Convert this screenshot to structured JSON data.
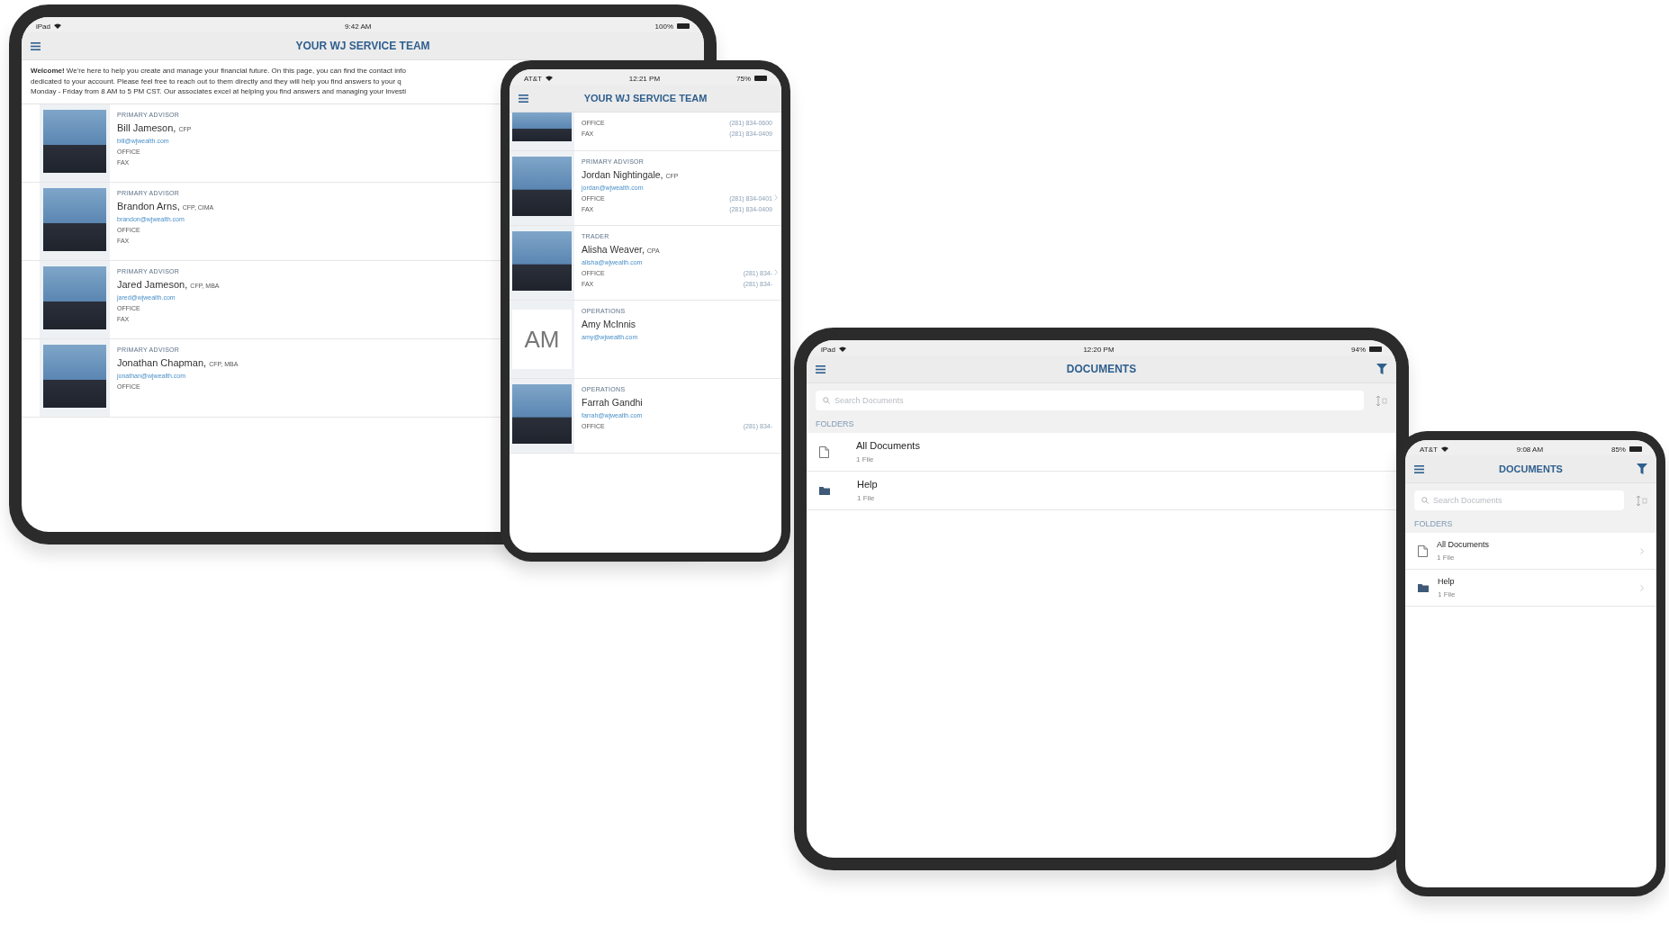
{
  "devices": [
    {
      "kind": "tablet",
      "status": {
        "carrier": "iPad",
        "time": "9:42 AM",
        "battery": "100%"
      },
      "title": "YOUR WJ SERVICE TEAM",
      "intro_lines": [
        "**Welcome!** We're here to help you create and manage your financial future. On this page, you can find the contact info",
        "dedicated to your account. Please feel free to reach out to them directly and they will help you find answers to your q",
        "Monday - Friday from 8 AM to 5 PM CST. Our associates excel at helping you find answers and managing your investi"
      ],
      "members": [
        {
          "role": "PRIMARY ADVISOR",
          "name": "Bill Jameson,",
          "credentials": "CFP",
          "email": "bill@wjwealth.com",
          "fields": [
            {
              "label": "OFFICE"
            },
            {
              "label": "FAX"
            }
          ]
        },
        {
          "role": "PRIMARY ADVISOR",
          "name": "Brandon Arns,",
          "credentials": "CFP, CIMA",
          "email": "brandon@wjwealth.com",
          "fields": [
            {
              "label": "OFFICE"
            },
            {
              "label": "FAX"
            }
          ]
        },
        {
          "role": "PRIMARY ADVISOR",
          "name": "Jared Jameson,",
          "credentials": "CFP, MBA",
          "email": "jared@wjwealth.com",
          "fields": [
            {
              "label": "OFFICE"
            },
            {
              "label": "FAX"
            }
          ]
        },
        {
          "role": "PRIMARY ADVISOR",
          "name": "Jonathan Chapman,",
          "credentials": "CFP, MBA",
          "email": "jonathan@wjwealth.com",
          "fields": [
            {
              "label": "OFFICE"
            }
          ]
        }
      ]
    },
    {
      "kind": "phone",
      "status": {
        "carrier": "AT&T",
        "time": "12:21 PM",
        "battery": "75%"
      },
      "title": "YOUR WJ SERVICE TEAM",
      "members": [
        {
          "cropped": true,
          "fields": [
            {
              "label": "OFFICE",
              "value": "(281) 834-0600"
            },
            {
              "label": "FAX",
              "value": "(281) 834-0409"
            }
          ]
        },
        {
          "role": "PRIMARY ADVISOR",
          "name": "Jordan Nightingale,",
          "credentials": "CFP",
          "email": "jordan@wjwealth.com",
          "chevron": true,
          "fields": [
            {
              "label": "OFFICE",
              "value": "(281) 834-0401"
            },
            {
              "label": "FAX",
              "value": "(281) 834-0409"
            }
          ]
        },
        {
          "role": "TRADER",
          "name": "Alisha Weaver,",
          "credentials": "CPA",
          "email": "alisha@wjwealth.com",
          "chevron": true,
          "fields": [
            {
              "label": "OFFICE",
              "value": "(281) 834-"
            },
            {
              "label": "FAX",
              "value": "(281) 834-"
            }
          ]
        },
        {
          "role": "OPERATIONS",
          "name": "Amy McInnis",
          "initials": "AM",
          "email": "amy@wjwealth.com"
        },
        {
          "role": "OPERATIONS",
          "name": "Farrah Gandhi",
          "email": "farrah@wjwealth.com",
          "fields": [
            {
              "label": "OFFICE",
              "value": "(281) 834-"
            }
          ]
        }
      ]
    },
    {
      "kind": "tablet",
      "status": {
        "carrier": "iPad",
        "time": "12:20 PM",
        "battery": "94%"
      },
      "title": "DOCUMENTS",
      "search": {
        "placeholder": "Search Documents"
      },
      "section": "FOLDERS",
      "folders": [
        {
          "kind": "file",
          "name": "All Documents",
          "count": "1 File"
        },
        {
          "kind": "folder",
          "name": "Help",
          "count": "1 File"
        }
      ]
    },
    {
      "kind": "phone",
      "chevrons": true,
      "status": {
        "carrier": "AT&T",
        "time": "9:08 AM",
        "battery": "85%"
      },
      "title": "DOCUMENTS",
      "search": {
        "placeholder": "Search Documents"
      },
      "section": "FOLDERS",
      "folders": [
        {
          "kind": "file",
          "name": "All Documents",
          "count": "1 File"
        },
        {
          "kind": "folder",
          "name": "Help",
          "count": "1 File"
        }
      ]
    }
  ]
}
